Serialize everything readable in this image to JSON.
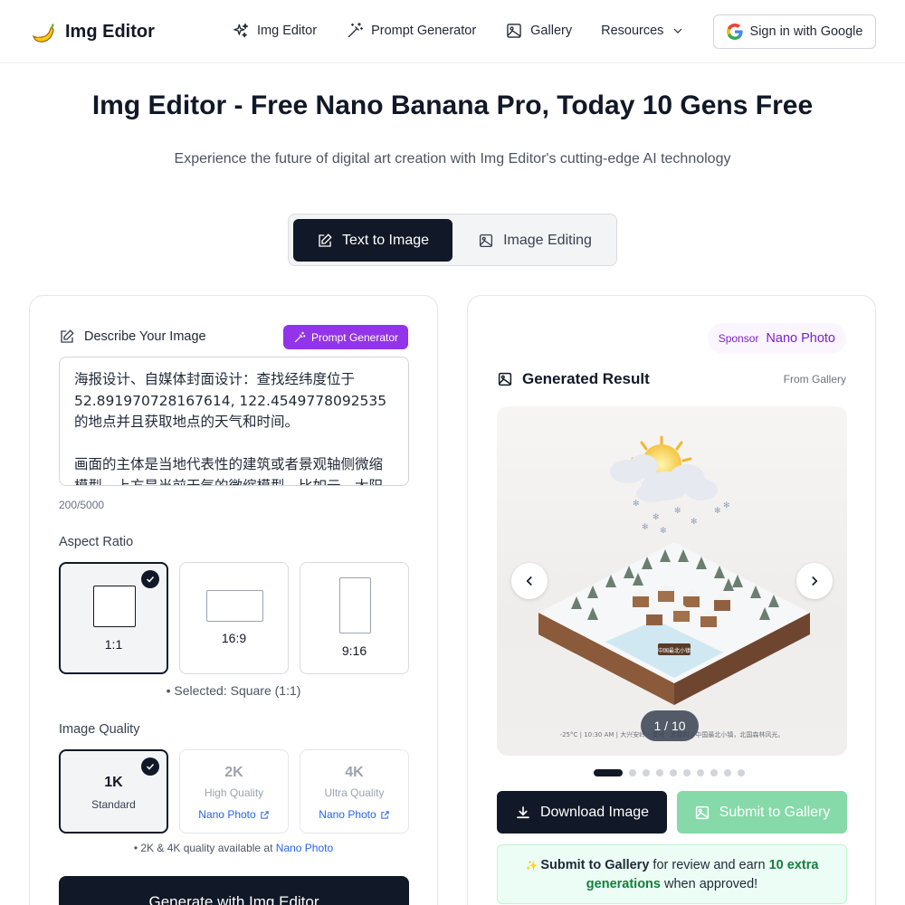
{
  "header": {
    "brand": "Img Editor",
    "nav": [
      {
        "label": "Img Editor",
        "icon": "sparkles-icon"
      },
      {
        "label": "Prompt Generator",
        "icon": "magic-wand-icon"
      },
      {
        "label": "Gallery",
        "icon": "image-icon"
      },
      {
        "label": "Resources",
        "icon": "chevron-down-icon"
      }
    ],
    "signin": "Sign in with Google"
  },
  "hero": {
    "title": "Img Editor - Free Nano Banana Pro, Today 10 Gens Free",
    "subtitle": "Experience the future of digital art creation with Img Editor's cutting-edge AI technology"
  },
  "mode_tabs": {
    "text_to_image": "Text to Image",
    "image_editing": "Image Editing",
    "active": "Text to Image"
  },
  "form": {
    "describe_label": "Describe Your Image",
    "prompt_generator_button": "Prompt Generator",
    "prompt_text": "海报设计、自媒体封面设计：查找经纬度位于52.891970728167614, 122.4549778092535 的地点并且获取地点的天气和时间。\n\n画面的主体是当地代表性的建筑或者景观轴侧微缩模型，上方是当前天气的微缩模型，比如云、太阳",
    "char_count": "200/5000",
    "aspect_label": "Aspect Ratio",
    "aspect_options": [
      {
        "label": "1:1"
      },
      {
        "label": "16:9"
      },
      {
        "label": "9:16"
      }
    ],
    "aspect_selected_note": "• Selected: Square (1:1)",
    "quality_label": "Image Quality",
    "quality_options": [
      {
        "title": "1K",
        "subtitle": "Standard",
        "link": ""
      },
      {
        "title": "2K",
        "subtitle": "High Quality",
        "link": "Nano Photo"
      },
      {
        "title": "4K",
        "subtitle": "Ultra Quality",
        "link": "Nano Photo"
      }
    ],
    "quality_note_prefix": "• 2K & 4K quality available at ",
    "quality_note_link": "Nano Photo",
    "generate_button": "Generate with Img Editor"
  },
  "result": {
    "sponsor_label": "Sponsor",
    "sponsor_name": "Nano Photo",
    "title": "Generated Result",
    "source": "From Gallery",
    "pager": "1 / 10",
    "image_caption": "-25°C | 10:30 AM | 大兴安岭 · 漠河 · 北极村 | 中国最北小镇，北国森林风光。",
    "image_sign": "中国最北小镇",
    "total_slides": 10,
    "current_slide": 1,
    "download_button": "Download Image",
    "submit_button": "Submit to Gallery",
    "info": {
      "bold_lead": "Submit to Gallery",
      "middle": " for review and earn ",
      "highlight": "10 extra generations",
      "tail": " when approved!"
    }
  },
  "colors": {
    "primary": "#111827",
    "purple": "#9333ea",
    "link_blue": "#2563eb",
    "green": "#15803d",
    "submit_green": "#86d9a8"
  }
}
